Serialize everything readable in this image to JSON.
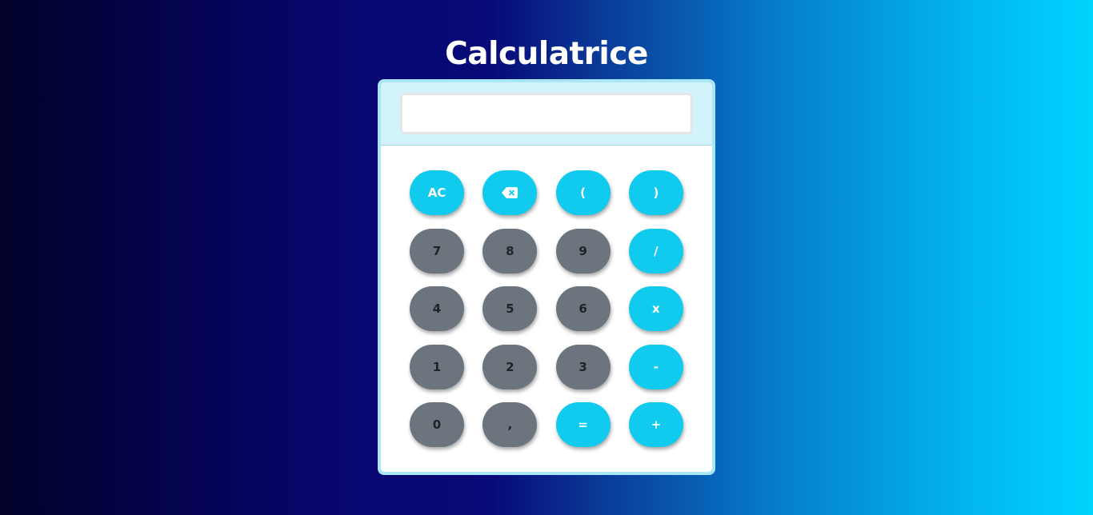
{
  "app": {
    "title": "Calculatrice"
  },
  "display": {
    "value": ""
  },
  "keys": [
    {
      "name": "clear-button",
      "label": "AC",
      "kind": "op"
    },
    {
      "name": "backspace-button",
      "label": "",
      "kind": "op",
      "icon": "backspace-icon"
    },
    {
      "name": "open-paren-button",
      "label": "(",
      "kind": "op"
    },
    {
      "name": "close-paren-button",
      "label": ")",
      "kind": "op"
    },
    {
      "name": "digit-7-button",
      "label": "7",
      "kind": "num"
    },
    {
      "name": "digit-8-button",
      "label": "8",
      "kind": "num"
    },
    {
      "name": "digit-9-button",
      "label": "9",
      "kind": "num"
    },
    {
      "name": "divide-button",
      "label": "/",
      "kind": "op"
    },
    {
      "name": "digit-4-button",
      "label": "4",
      "kind": "num"
    },
    {
      "name": "digit-5-button",
      "label": "5",
      "kind": "num"
    },
    {
      "name": "digit-6-button",
      "label": "6",
      "kind": "num"
    },
    {
      "name": "multiply-button",
      "label": "x",
      "kind": "op"
    },
    {
      "name": "digit-1-button",
      "label": "1",
      "kind": "num"
    },
    {
      "name": "digit-2-button",
      "label": "2",
      "kind": "num"
    },
    {
      "name": "digit-3-button",
      "label": "3",
      "kind": "num"
    },
    {
      "name": "subtract-button",
      "label": "-",
      "kind": "op"
    },
    {
      "name": "digit-0-button",
      "label": "0",
      "kind": "num"
    },
    {
      "name": "decimal-comma-button",
      "label": ",",
      "kind": "num"
    },
    {
      "name": "equals-button",
      "label": "=",
      "kind": "op"
    },
    {
      "name": "add-button",
      "label": "+",
      "kind": "op"
    }
  ],
  "colors": {
    "operator_key": "#10cbee",
    "digit_key": "#6c757d",
    "digit_text": "#1f2327",
    "screen_panel": "#d2f3fb",
    "frame": "#a9e6f8"
  }
}
